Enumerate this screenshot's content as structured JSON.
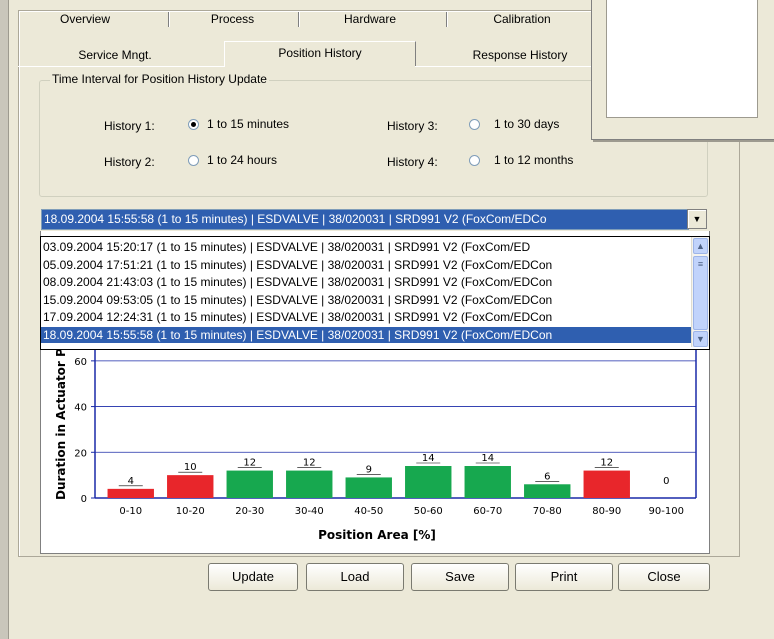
{
  "tabs_row1": [
    "Overview",
    "Process",
    "Hardware",
    "Calibration"
  ],
  "tabs_row2": [
    "Service Mngt.",
    "Position History",
    "Response History"
  ],
  "active_tab": "Position History",
  "interval_group": {
    "title": "Time Interval for Position History Update",
    "options": [
      {
        "label": "History 1:",
        "value": "1 to 15 minutes",
        "selected": true
      },
      {
        "label": "History 2:",
        "value": "1 to 24 hours",
        "selected": false
      },
      {
        "label": "History 3:",
        "value": "1 to 30 days",
        "selected": false
      },
      {
        "label": "History 4:",
        "value": "1 to 12 months",
        "selected": false
      }
    ]
  },
  "record_select": {
    "value": "18.09.2004 15:55:58 (1 to 15 minutes) | ESDVALVE | 38/020031 | SRD991 V2 (FoxCom/EDCo",
    "options": [
      "03.09.2004 15:20:17 (1 to 15 minutes) | ESDVALVE       | 38/020031 | SRD991 V2 (FoxCom/ED",
      "05.09.2004 17:51:21 (1 to 15 minutes) | ESDVALVE | 38/020031 | SRD991 V2 (FoxCom/EDCon",
      "08.09.2004 21:43:03 (1 to 15 minutes) | ESDVALVE | 38/020031 | SRD991 V2 (FoxCom/EDCon",
      "15.09.2004 09:53:05 (1 to 15 minutes) | ESDVALVE | 38/020031 | SRD991 V2 (FoxCom/EDCon",
      "17.09.2004 12:24:31 (1 to 15 minutes) | ESDVALVE | 38/020031 | SRD991 V2 (FoxCom/EDCon",
      "18.09.2004 15:55:58 (1 to 15 minutes) | ESDVALVE | 38/020031 | SRD991 V2 (FoxCom/EDCon"
    ],
    "selected_index": 5
  },
  "chart_data": {
    "type": "bar",
    "title": "",
    "xlabel": "Position Area [%]",
    "ylabel": "Duration in Actuator P",
    "categories": [
      "0-10",
      "10-20",
      "20-30",
      "30-40",
      "40-50",
      "50-60",
      "60-70",
      "70-80",
      "80-90",
      "90-100"
    ],
    "values": [
      4,
      10,
      12,
      12,
      9,
      14,
      14,
      6,
      12,
      0
    ],
    "colors": [
      "#e8262b",
      "#e8262b",
      "#17a84f",
      "#17a84f",
      "#17a84f",
      "#17a84f",
      "#17a84f",
      "#17a84f",
      "#e8262b",
      "#e8262b"
    ],
    "yticks": [
      0,
      20,
      40,
      60
    ],
    "ylim": [
      0,
      70
    ],
    "grid": true
  },
  "buttons": [
    "Update",
    "Load",
    "Save",
    "Print",
    "Close"
  ],
  "colors": {
    "background": "#ece9d8",
    "selection": "#2f5fb0",
    "bar_red": "#e8262b",
    "bar_green": "#17a84f",
    "axis": "#1a2aa8"
  }
}
